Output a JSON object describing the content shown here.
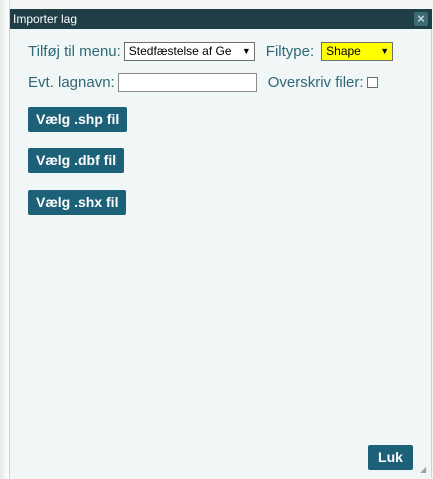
{
  "dialog": {
    "title": "Importer lag",
    "close_icon": "close-x-icon"
  },
  "form": {
    "menu_label": "Tilføj til menu:",
    "menu_value": "Stedfæstelse af Ge",
    "filetype_label": "Filtype:",
    "filetype_value": "Shape",
    "filetype_highlight": "#ffff00",
    "layername_label": "Evt. lagnavn:",
    "layername_value": "",
    "overwrite_label": "Overskriv filer:",
    "overwrite_checked": false
  },
  "buttons": {
    "shp": "Vælg .shp fil",
    "dbf": "Vælg .dbf fil",
    "shx": "Vælg .shx fil",
    "close": "Luk"
  },
  "colors": {
    "titlebar": "#1f3e45",
    "button": "#1d6178",
    "label": "#2f6776"
  }
}
